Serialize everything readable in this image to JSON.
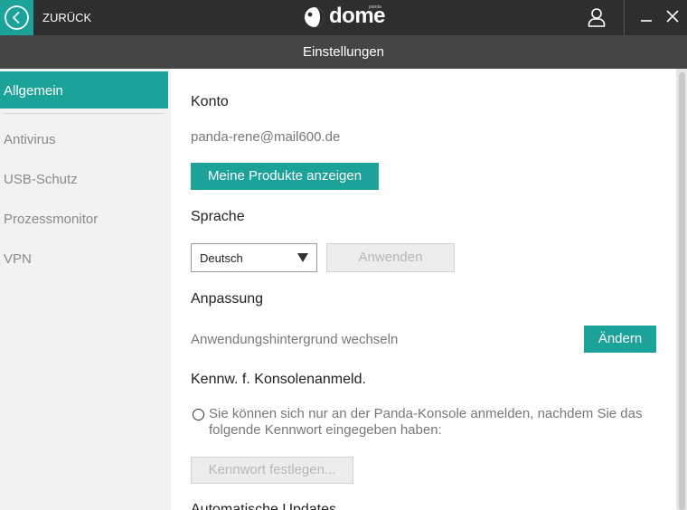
{
  "header": {
    "back_label": "ZURÜCK",
    "logo_text": "dome",
    "logo_sub": "panda",
    "title": "Einstellungen"
  },
  "sidebar": {
    "items": [
      {
        "label": "Allgemein",
        "active": true
      },
      {
        "label": "Antivirus",
        "active": false
      },
      {
        "label": "USB-Schutz",
        "active": false
      },
      {
        "label": "Prozessmonitor",
        "active": false
      },
      {
        "label": "VPN",
        "active": false
      }
    ]
  },
  "account": {
    "heading": "Konto",
    "email": "panda-rene@mail600.de",
    "products_button": "Meine Produkte anzeigen"
  },
  "language": {
    "heading": "Sprache",
    "selected": "Deutsch",
    "apply_button": "Anwenden"
  },
  "customization": {
    "heading": "Anpassung",
    "background_label": "Anwendungshintergrund wechseln",
    "change_button": "Ändern"
  },
  "console_password": {
    "heading": "Kennw. f. Konsolenanmeld.",
    "option_text": "Sie können sich nur an der Panda-Konsole anmelden, nachdem Sie das folgende Kennwort eingegeben haben:",
    "set_button": "Kennwort festlegen..."
  },
  "updates": {
    "heading": "Automatische Updates"
  },
  "colors": {
    "accent": "#1ba39a",
    "topbar": "#2e2e2e",
    "titlebar": "#454545"
  }
}
